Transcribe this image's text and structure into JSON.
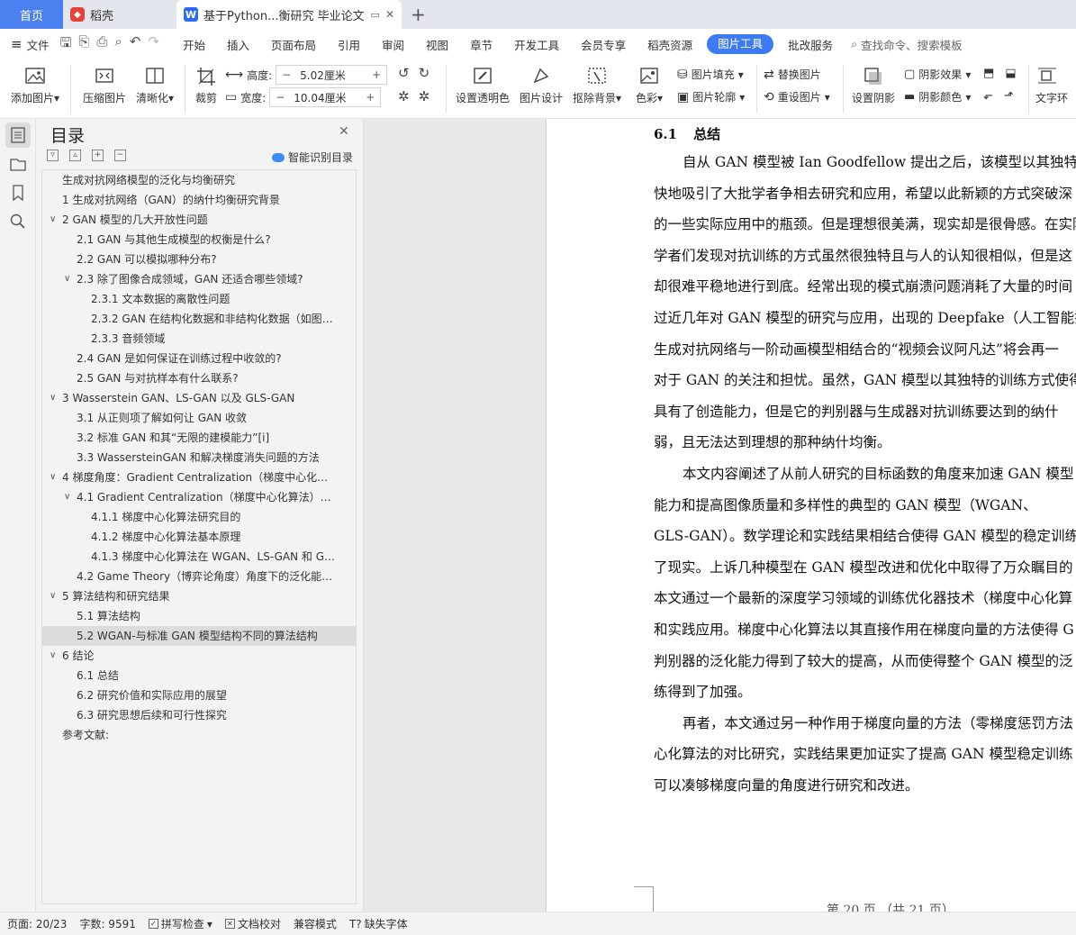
{
  "tabs": {
    "home": "首页",
    "daoke": "稻壳",
    "doc": "基于Python...衡研究 毕业论文",
    "new_tab_symbol": "+"
  },
  "menubar": {
    "file": "文件",
    "items": [
      "开始",
      "插入",
      "页面布局",
      "引用",
      "审阅",
      "视图",
      "章节",
      "开发工具",
      "会员专享",
      "稻壳资源"
    ],
    "active": "图片工具",
    "after": "批改服务",
    "search": "查找命令、搜索模板"
  },
  "ribbon": {
    "add_image": "添加图片",
    "compress": "压缩图片",
    "sharpen": "清晰化",
    "crop": "裁剪",
    "height_label": "高度:",
    "height_value": "5.02厘米",
    "width_label": "宽度:",
    "width_value": "10.04厘米",
    "set_transparent": "设置透明色",
    "image_design": "图片设计",
    "remove_bg": "抠除背景",
    "color": "色彩",
    "fill": "图片填充",
    "outline": "图片轮廓",
    "replace": "替换图片",
    "reset": "重设图片",
    "shadow_settings": "设置阴影",
    "shadow_effect": "阴影效果",
    "shadow_color": "阴影颜色",
    "text_wrap": "文字环"
  },
  "toc": {
    "title": "目录",
    "smart": "智能识别目录",
    "items": [
      {
        "level": 0,
        "text": "生成对抗网络模型的泛化与均衡研究"
      },
      {
        "level": 1,
        "text": "1   生成对抗网络（GAN）的纳什均衡研究背景"
      },
      {
        "level": 1,
        "chev": "v",
        "text": "2   GAN 模型的几大开放性问题"
      },
      {
        "level": 2,
        "text": "2.1   GAN 与其他生成模型的权衡是什么?"
      },
      {
        "level": 2,
        "text": "2.2   GAN 可以模拟哪种分布?"
      },
      {
        "level": 2,
        "chev": "v",
        "text": "2.3   除了图像合成领域，GAN 还适合哪些领域?"
      },
      {
        "level": 3,
        "text": "2.3.1   文本数据的离散性问题"
      },
      {
        "level": 3,
        "text": "2.3.2   GAN 在结构化数据和非结构化数据（如图…"
      },
      {
        "level": 3,
        "text": "2.3.3   音频领域"
      },
      {
        "level": 2,
        "text": "2.4   GAN 是如何保证在训练过程中收敛的?"
      },
      {
        "level": 2,
        "text": "2.5   GAN 与对抗样本有什么联系?"
      },
      {
        "level": 1,
        "chev": "v",
        "text": "3   Wasserstein GAN、LS-GAN 以及 GLS-GAN"
      },
      {
        "level": 2,
        "text": "3.1   从正则项了解如何让 GAN 收敛"
      },
      {
        "level": 2,
        "text": "3.2   标准 GAN 和其“无限的建模能力”[i]"
      },
      {
        "level": 2,
        "text": "3.3   WassersteinGAN 和解决梯度消失问题的方法"
      },
      {
        "level": 1,
        "chev": "v",
        "text": "4   梯度角度：Gradient Centralization（梯度中心化…"
      },
      {
        "level": 2,
        "chev": "v",
        "text": "4.1   Gradient Centralization（梯度中心化算法）…"
      },
      {
        "level": 3,
        "text": "4.1.1   梯度中心化算法研究目的"
      },
      {
        "level": 3,
        "text": "4.1.2   梯度中心化算法基本原理"
      },
      {
        "level": 3,
        "text": "4.1.3   梯度中心化算法在 WGAN、LS-GAN 和 G…"
      },
      {
        "level": 2,
        "text": "4.2   Game Theory（博弈论角度）角度下的泛化能…"
      },
      {
        "level": 1,
        "chev": "v",
        "text": "5   算法结构和研究结果"
      },
      {
        "level": 2,
        "text": "5.1   算法结构"
      },
      {
        "level": 2,
        "sel": true,
        "text": "5.2   WGAN-与标准 GAN 模型结构不同的算法结构"
      },
      {
        "level": 1,
        "chev": "v",
        "text": "6   结论"
      },
      {
        "level": 2,
        "text": "6.1   总结"
      },
      {
        "level": 2,
        "text": "6.2   研究价值和实际应用的展望"
      },
      {
        "level": 2,
        "text": "6.3   研究思想后续和可行性探究"
      },
      {
        "level": 0,
        "text": "参考文献:"
      }
    ]
  },
  "doc": {
    "heading_num": "6.1",
    "heading_text": "总结",
    "lines": [
      {
        "indent": true,
        "text": "自从 GAN 模型被 Ian Goodfellow 提出之后，该模型以其独特的"
      },
      {
        "indent": false,
        "text": "快地吸引了大批学者争相去研究和应用，希望以此新颖的方式突破深"
      },
      {
        "indent": false,
        "text": "的一些实际应用中的瓶颈。但是理想很美满，现实却是很骨感。在实际"
      },
      {
        "indent": false,
        "text": "学者们发现对抗训练的方式虽然很独特且与人的认知很相似，但是这"
      },
      {
        "indent": false,
        "text": "却很难平稳地进行到底。经常出现的模式崩溃问题消耗了大量的时间"
      },
      {
        "indent": false,
        "text": "过近几年对 GAN 模型的研究与应用，出现的 Deepfake（人工智能换"
      },
      {
        "indent": false,
        "text": "生成对抗网络与一阶动画模型相结合的“视频会议阿凡达”将会再一"
      },
      {
        "indent": false,
        "text": "对于 GAN 的关注和担忧。虽然，GAN 模型以其独特的训练方式使得"
      },
      {
        "indent": false,
        "text": "具有了创造能力，但是它的判别器与生成器对抗训练要达到的纳什"
      },
      {
        "indent": false,
        "text": "弱，且无法达到理想的那种纳什均衡。"
      },
      {
        "indent": true,
        "text": "本文内容阐述了从前人研究的目标函数的角度来加速 GAN 模型"
      },
      {
        "indent": false,
        "text": "能力和提高图像质量和多样性的典型的 GAN 模型（WGAN、"
      },
      {
        "indent": false,
        "text": "GLS-GAN）。数学理论和实践结果相结合使得 GAN 模型的稳定训练"
      },
      {
        "indent": false,
        "text": "了现实。上诉几种模型在 GAN 模型改进和优化中取得了万众瞩目的"
      },
      {
        "indent": false,
        "text": "本文通过一个最新的深度学习领域的训练优化器技术（梯度中心化算"
      },
      {
        "indent": false,
        "text": "和实践应用。梯度中心化算法以其直接作用在梯度向量的方法使得 G"
      },
      {
        "indent": false,
        "text": "判别器的泛化能力得到了较大的提高，从而使得整个 GAN 模型的泛"
      },
      {
        "indent": false,
        "text": "练得到了加强。"
      },
      {
        "indent": true,
        "text": "再者，本文通过另一种作用于梯度向量的方法（零梯度惩罚方法"
      },
      {
        "indent": false,
        "text": "心化算法的对比研究，实践结果更加证实了提高 GAN 模型稳定训练"
      },
      {
        "indent": false,
        "text": "可以凑够梯度向量的角度进行研究和改进。"
      }
    ],
    "footer": "第 20 页 （共 21 页）"
  },
  "status": {
    "page": "页面: 20/23",
    "words": "字数: 9591",
    "spell": "拼写检查",
    "proof": "文档校对",
    "compat": "兼容模式",
    "missing_font": "缺失字体"
  }
}
